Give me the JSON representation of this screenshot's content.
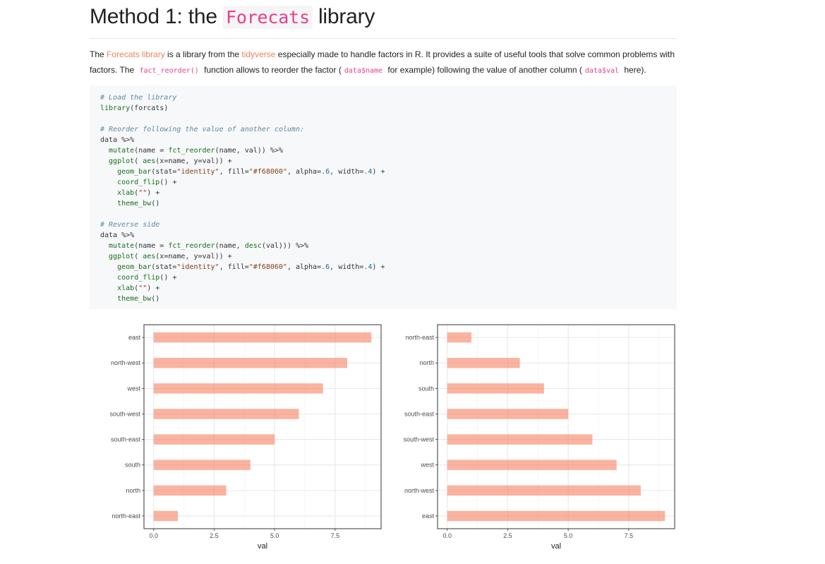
{
  "heading": {
    "prefix": "Method 1: the ",
    "code": "Forecats",
    "suffix": " library"
  },
  "paragraph": {
    "t1": "The ",
    "link1": "Forecats library",
    "t2": " is a library from the ",
    "link2": "tidyverse",
    "t3": " especially made to handle factors in R. It provides a suite of useful tools that solve common problems with factors. The ",
    "code1": "fact_reorder()",
    "t4": " function allows to reorder the factor (",
    "code2": "data$name",
    "t5": " for example) following the value of another column (",
    "code3": "data$val",
    "t6": " here)."
  },
  "code": {
    "c1": "# Load the library",
    "l1a": "library",
    "l1b": "(forcats)",
    "c2": "# Reorder following the value of another column:",
    "l3": "data %>%",
    "l4a": "  mutate",
    "l4b": "(name = ",
    "l4c": "fct_reorder",
    "l4d": "(name, val)) %>%",
    "l5a": "  ggplot",
    "l5b": "( ",
    "l5c": "aes",
    "l5d": "(x=name, y=val)) +",
    "l6a": "    geom_bar",
    "l6b": "(stat=",
    "l6c": "\"identity\"",
    "l6d": ", fill=",
    "l6e": "\"#f68060\"",
    "l6f": ", alpha=",
    "l6g": ".6",
    "l6h": ", width=",
    "l6i": ".4",
    "l6j": ") +",
    "l7a": "    coord_flip",
    "l7b": "() +",
    "l8a": "    xlab",
    "l8b": "(",
    "l8c": "\"\"",
    "l8d": ") +",
    "l9a": "    theme_bw",
    "l9b": "()",
    "c3": "# Reverse side",
    "r4d": "(name, ",
    "r4e": "desc",
    "r4f": "(val))) %>%"
  },
  "chart_data": [
    {
      "type": "bar",
      "orientation": "horizontal",
      "categories": [
        "east",
        "north-west",
        "west",
        "south-west",
        "south-east",
        "south",
        "north",
        "north-east"
      ],
      "values": [
        9,
        8,
        7,
        6,
        5,
        4,
        3,
        1
      ],
      "xlabel": "val",
      "xlim": [
        0,
        9
      ],
      "xticks": [
        "0.0",
        "2.5",
        "5.0",
        "7.5"
      ],
      "bar_color": "#f68060",
      "grid": true
    },
    {
      "type": "bar",
      "orientation": "horizontal",
      "categories": [
        "north-east",
        "north",
        "south",
        "south-east",
        "south-west",
        "west",
        "north-west",
        "east"
      ],
      "values": [
        1,
        3,
        4,
        5,
        6,
        7,
        8,
        9
      ],
      "xlabel": "val",
      "xlim": [
        0,
        9
      ],
      "xticks": [
        "0.0",
        "2.5",
        "5.0",
        "7.5"
      ],
      "bar_color": "#f68060",
      "grid": true
    }
  ]
}
